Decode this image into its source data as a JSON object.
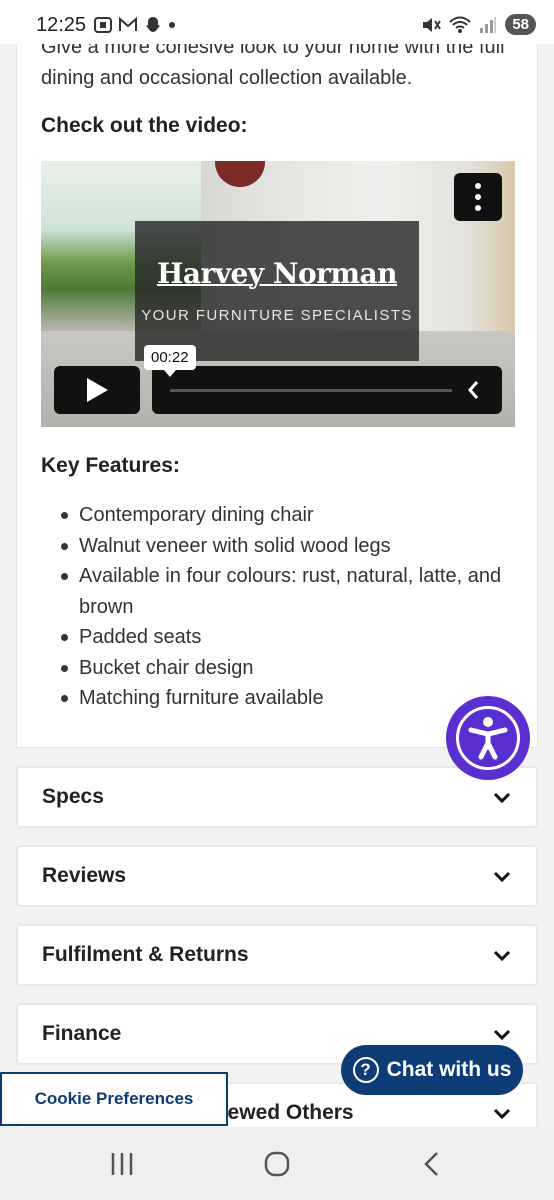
{
  "status_bar": {
    "time": "12:25",
    "left_icons": [
      "screenshot-icon",
      "gmail-icon",
      "snapchat-icon",
      "dot-icon"
    ],
    "battery": "58"
  },
  "product": {
    "intro_text": "Give a more cohesive look to your home with the full dining and occasional collection available.",
    "video_heading": "Check out the video:",
    "video": {
      "brand": "Harvey Norman",
      "tagline": "YOUR FURNITURE SPECIALISTS",
      "timestamp": "00:22"
    },
    "features_heading": "Key Features:",
    "features": [
      "Contemporary dining chair",
      "Walnut veneer with solid wood legs",
      "Available in four colours: rust, natural, latte, and brown",
      "Padded seats",
      "Bucket chair design",
      "Matching furniture available"
    ]
  },
  "accordion": [
    {
      "label": "Specs"
    },
    {
      "label": "Reviews"
    },
    {
      "label": "Fulfilment & Returns"
    },
    {
      "label": "Finance"
    },
    {
      "label": "Customers Also Viewed Others"
    }
  ],
  "floating": {
    "chat_label": "Chat with us",
    "cookie_label": "Cookie Preferences"
  },
  "colors": {
    "accessibility": "#5a2fd0",
    "chat": "#0d3c77"
  }
}
